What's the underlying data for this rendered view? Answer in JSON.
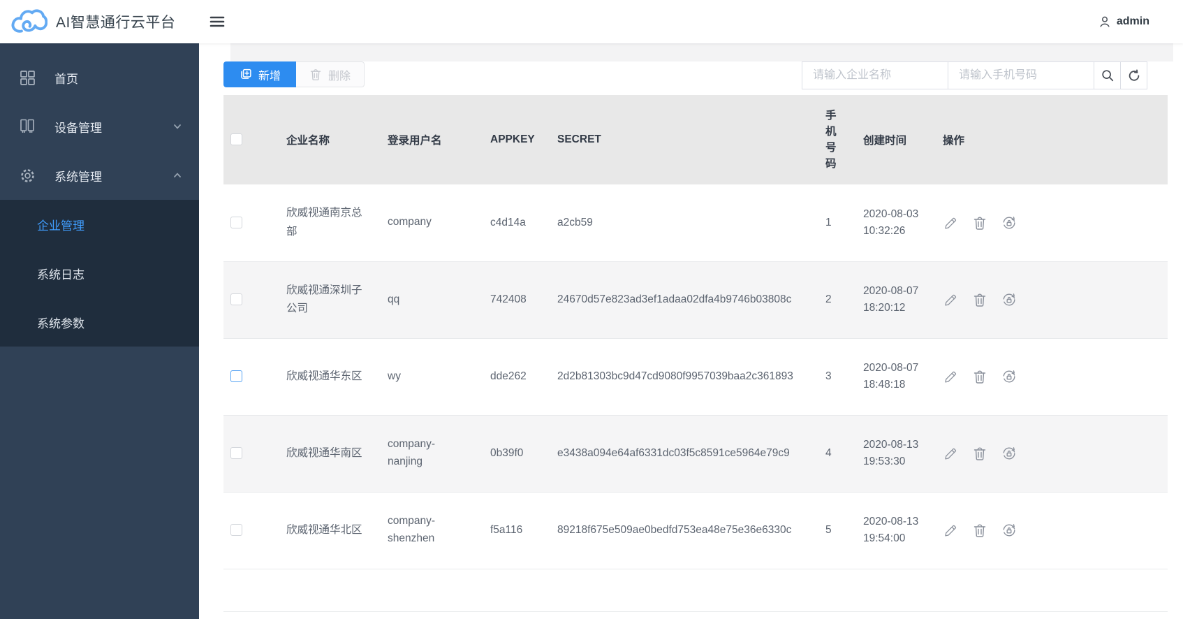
{
  "app": {
    "title": "AI智慧通行云平台",
    "user": "admin"
  },
  "sidebar": {
    "items": [
      {
        "label": "首页"
      },
      {
        "label": "设备管理"
      },
      {
        "label": "系统管理"
      }
    ],
    "submenu": [
      {
        "label": "企业管理",
        "active": true
      },
      {
        "label": "系统日志",
        "active": false
      },
      {
        "label": "系统参数",
        "active": false
      }
    ]
  },
  "toolbar": {
    "add_label": "新增",
    "delete_label": "删除",
    "company_placeholder": "请输入企业名称",
    "phone_placeholder": "请输入手机号码"
  },
  "table": {
    "headers": {
      "company": "企业名称",
      "username": "登录用户名",
      "appkey": "APPKEY",
      "secret": "SECRET",
      "phone": "手机号码",
      "created": "创建时间",
      "actions": "操作"
    },
    "rows": [
      {
        "company": "欣威视通南京总部",
        "username": "company",
        "appkey": "c4d14a",
        "secret": "a2cb59",
        "phone": "1",
        "created": "2020-08-03 10:32:26",
        "checkbox_highlighted": false
      },
      {
        "company": "欣威视通深圳子公司",
        "username": "qq",
        "appkey": "742408",
        "secret": "24670d57e823ad3ef1adaa02dfa4b9746b03808c",
        "phone": "2",
        "created": "2020-08-07 18:20:12",
        "checkbox_highlighted": false
      },
      {
        "company": "欣威视通华东区",
        "username": "wy",
        "appkey": "dde262",
        "secret": "2d2b81303bc9d47cd9080f9957039baa2c361893",
        "phone": "3",
        "created": "2020-08-07 18:48:18",
        "checkbox_highlighted": true
      },
      {
        "company": "欣威视通华南区",
        "username": "company-nanjing",
        "appkey": "0b39f0",
        "secret": "e3438a094e64af6331dc03f5c8591ce5964e79c9",
        "phone": "4",
        "created": "2020-08-13 19:53:30",
        "checkbox_highlighted": false
      },
      {
        "company": "欣威视通华北区",
        "username": "company-shenzhen",
        "appkey": "f5a116",
        "secret": "89218f675e509ae0bedfd753ea48e75e36e6330c",
        "phone": "5",
        "created": "2020-08-13 19:54:00",
        "checkbox_highlighted": false
      }
    ]
  },
  "colors": {
    "primary": "#2d8cf0",
    "active_menu": "#409eff",
    "sidebar_bg": "#304156",
    "submenu_bg": "#1f2d3d",
    "table_header_bg": "#e8e8e8",
    "stripe_bg": "#f5f5f6"
  }
}
